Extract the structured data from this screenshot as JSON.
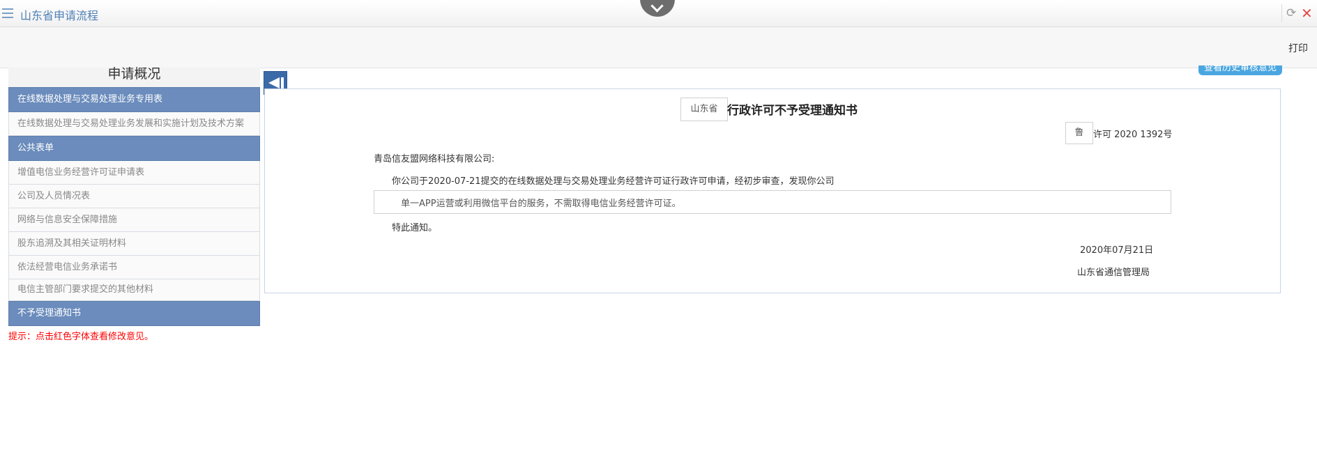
{
  "window": {
    "title": "山东省申请流程",
    "icons": {
      "menu": "menu-icon",
      "pull_tab": "chevron-down-icon",
      "refresh": "refresh-icon",
      "close": "close-icon"
    },
    "refresh_glyph": "⟳",
    "close_glyph": "✕"
  },
  "toolbar": {
    "print_label": "打印"
  },
  "sidebar": {
    "title": "申请概况",
    "sections": [
      {
        "label": "在线数据处理与交易处理业务专用表",
        "items": [
          "在线数据处理与交易处理业务发展和实施计划及技术方案"
        ]
      },
      {
        "label": "公共表单",
        "items": [
          "增值电信业务经营许可证申请表",
          "公司及人员情况表",
          "网络与信息安全保障措施",
          "股东追溯及其相关证明材料",
          "依法经营电信业务承诺书",
          "电信主管部门要求提交的其他材料"
        ]
      },
      {
        "label": "不予受理通知书",
        "items": []
      }
    ]
  },
  "hint": "提示：点击红色字体查看修改意见。",
  "history_button": "查看历史审核意见",
  "notice": {
    "province": "山东省",
    "title": "行政许可不予受理通知书",
    "lu": "鲁",
    "permit_no": "许可 2020  1392号",
    "recipient": "青岛信友盟网络科技有限公司:",
    "body": "你公司于2020-07-21提交的在线数据处理与交易处理业务经营许可证行政许可申请，经初步审查，发现你公司",
    "reason": "单一APP运营或利用微信平台的服务，不需取得电信业务经营许可证。",
    "closing": "特此通知。",
    "date": "2020年07月21日",
    "issuer": "山东省通信管理局"
  },
  "colors": {
    "accent": "#4e7fb5",
    "section_header": "#6b8cbc",
    "hint": "#ff0000",
    "close": "#e24a4a"
  }
}
